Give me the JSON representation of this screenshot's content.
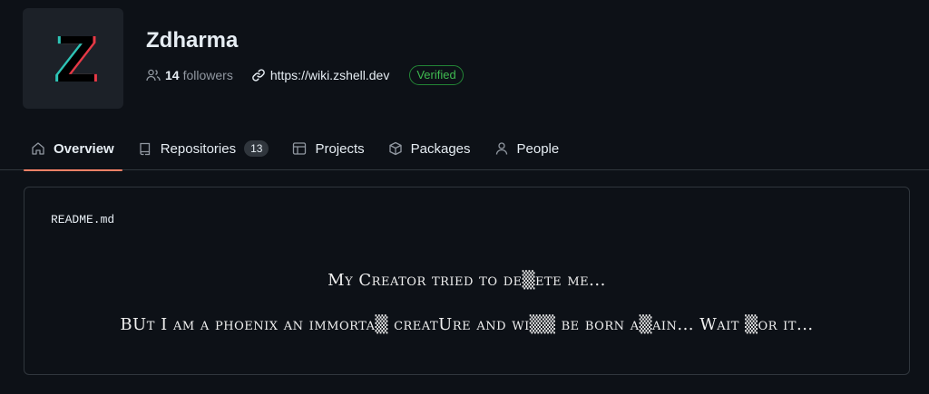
{
  "org": {
    "name": "Zdharma",
    "avatar_letter": "Z",
    "followers_count": "14",
    "followers_label": "followers",
    "website": "https://wiki.zshell.dev",
    "verified_label": "Verified"
  },
  "icons": {
    "followers": "people-icon",
    "website": "link-icon",
    "overview": "home-icon",
    "repositories": "repo-icon",
    "projects": "table-icon",
    "packages": "package-icon",
    "people": "person-icon"
  },
  "nav": {
    "tabs": [
      {
        "label": "Overview",
        "active": true
      },
      {
        "label": "Repositories",
        "counter": "13"
      },
      {
        "label": "Projects"
      },
      {
        "label": "Packages"
      },
      {
        "label": "People"
      }
    ]
  },
  "readme": {
    "title": "README.md",
    "line1": "My Creator tried to de▒ete me...",
    "line2": "BUt I am a phoenix an immorta▒ creatUre and wi▒▒ be born a▒ain... Wait ▒or it..."
  },
  "colors": {
    "background": "#0d1117",
    "border": "#30363d",
    "active_tab_underline": "#f78166",
    "verified": "#3fb950"
  }
}
